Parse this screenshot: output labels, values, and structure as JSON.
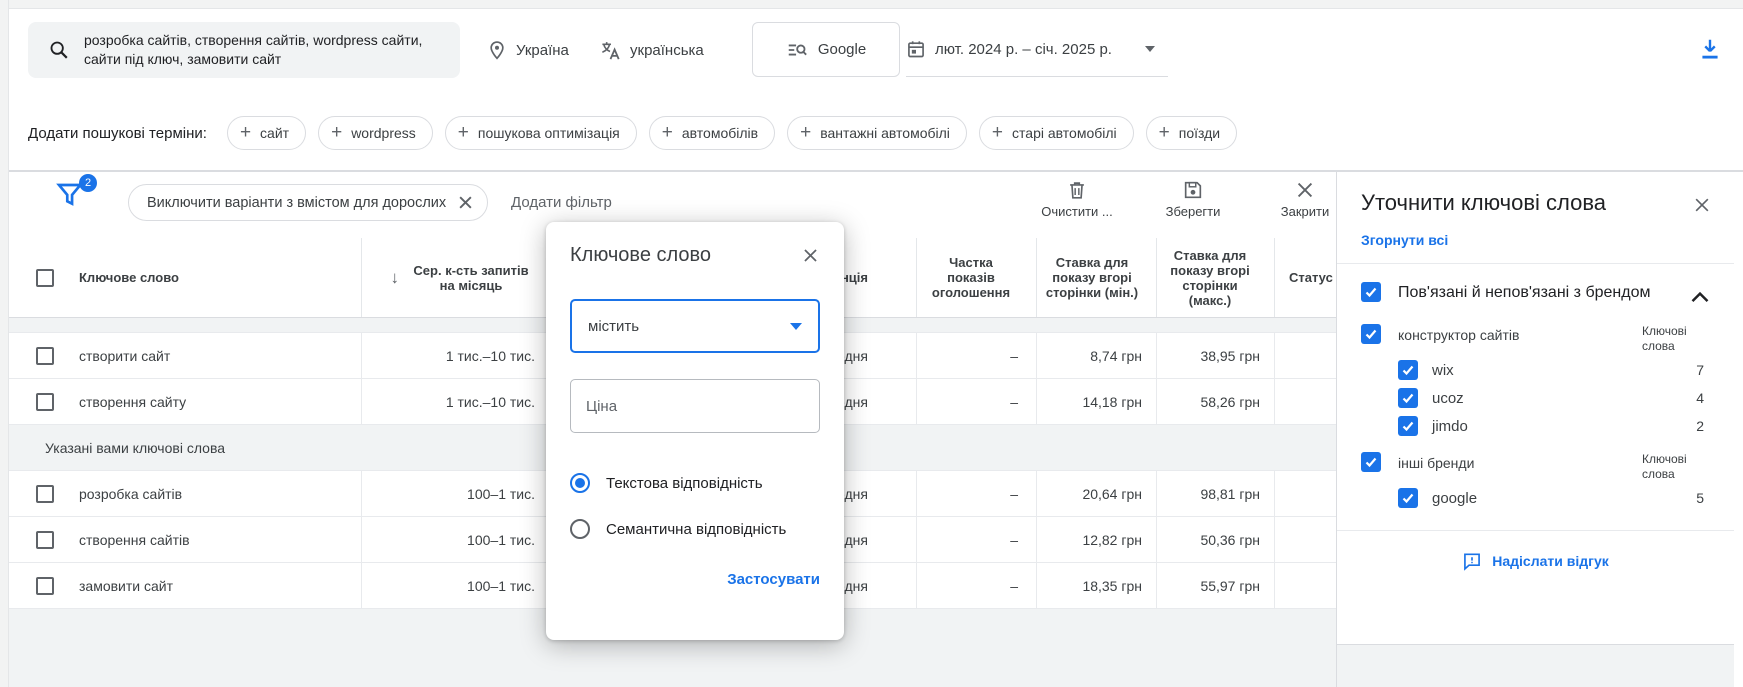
{
  "toolbar": {
    "keywords": "розробка сайтів, створення сайтів, wordpress сайти, сайти під ключ, замовити сайт",
    "location": "Україна",
    "language": "українська",
    "network": "Google",
    "date_range": "лют. 2024 р. – січ. 2025 р."
  },
  "terms_bar": {
    "label": "Додати пошукові терміни:",
    "chips": [
      "сайт",
      "wordpress",
      "пошукова оптимізація",
      "автомобілів",
      "вантажні автомобілі",
      "старі автомобілі",
      "поїзди"
    ]
  },
  "filter_bar": {
    "badge_count": "2",
    "active_filter": "Виключити варіанти з вмістом для дорослих",
    "add_filter_label": "Додати фільтр",
    "clear_label": "Очистити ...",
    "save_label": "Зберегти",
    "close_label": "Закрити"
  },
  "table": {
    "headers": {
      "keyword": "Ключове слово",
      "volume": "Сер. к-сть запитів на місяць",
      "competition": "Конкуренція",
      "impression_share": "Частка показів оголошення",
      "top_bid_min": "Ставка для показу вгорі сторінки (мін.)",
      "top_bid_max": "Ставка для показу вгорі сторінки (макс.)",
      "status": "Статус"
    },
    "section_label": "Указані вами ключові слова",
    "rows": [
      {
        "keyword": "створити сайт",
        "volume": "1 тис.–10 тис.",
        "competition": "Середня",
        "share": "–",
        "bid_min": "8,74 грн",
        "bid_max": "38,95 грн"
      },
      {
        "keyword": "створення сайту",
        "volume": "1 тис.–10 тис.",
        "competition": "Середня",
        "share": "–",
        "bid_min": "14,18 грн",
        "bid_max": "58,26 грн"
      },
      {
        "keyword": "розробка сайтів",
        "volume": "100–1 тис.",
        "competition": "Середня",
        "share": "–",
        "bid_min": "20,64 грн",
        "bid_max": "98,81 грн"
      },
      {
        "keyword": "створення сайтів",
        "volume": "100–1 тис.",
        "competition": "Середня",
        "share": "–",
        "bid_min": "12,82 грн",
        "bid_max": "50,36 грн"
      },
      {
        "keyword": "замовити сайт",
        "volume": "100–1 тис.",
        "competition": "Середня",
        "share": "–",
        "bid_min": "18,35 грн",
        "bid_max": "55,97 грн"
      }
    ]
  },
  "filter_dialog": {
    "title": "Ключове слово",
    "operator_value": "містить",
    "value_placeholder": "Ціна",
    "option_text_match": "Текстова відповідність",
    "option_semantic_match": "Семантична відповідність",
    "apply_label": "Застосувати"
  },
  "refine_panel": {
    "title": "Уточнити ключові слова",
    "collapse_all_label": "Згорнути всі",
    "keywords_col_label": "Ключові слова",
    "group": {
      "label": "Пов'язані й непов'язані з брендом",
      "subgroups": [
        {
          "label": "конструктор сайтів",
          "items": [
            {
              "label": "wix",
              "count": "7"
            },
            {
              "label": "ucoz",
              "count": "4"
            },
            {
              "label": "jimdo",
              "count": "2"
            }
          ]
        },
        {
          "label": "інші бренди",
          "items": [
            {
              "label": "google",
              "count": "5"
            }
          ]
        }
      ]
    },
    "feedback_label": "Надіслати відгук"
  },
  "ui_colors": {
    "accent_blue": "#1a73e8",
    "icon_gray": "#5f6368"
  }
}
